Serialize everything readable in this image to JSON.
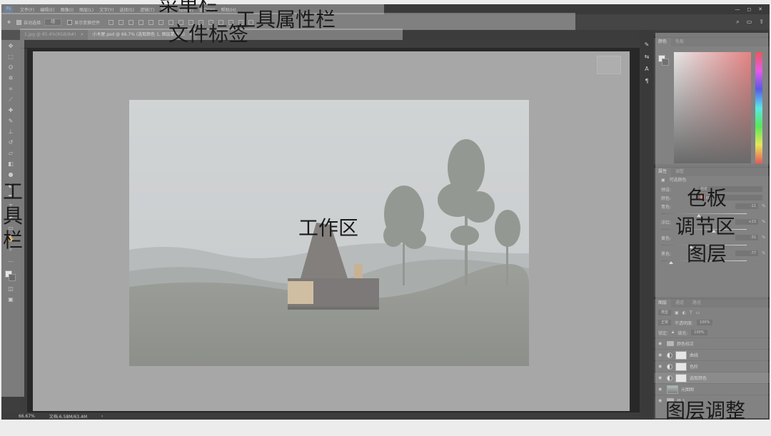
{
  "menubar": {
    "logo": "Ps",
    "items": [
      "文件(F)",
      "编辑(E)",
      "图像(I)",
      "图层(L)",
      "文字(Y)",
      "选择(S)",
      "滤镜(T)",
      "3D(D)",
      "视图(V)",
      "窗口(W)",
      "帮助(H)"
    ],
    "controls": [
      "—",
      "◻",
      "✕"
    ]
  },
  "optionsbar": {
    "auto_select_label": "自动选择:",
    "auto_select_value": "组",
    "transform_label": "显示变换控件"
  },
  "doc_tabs": [
    {
      "label": "1.jpg @ 85.4%(RGB/8#)",
      "close": "×"
    },
    {
      "label": "小木屋.psd @ 66.7% (选取颜色 1, 图层蒙版/8)",
      "close": "×"
    }
  ],
  "statusbar": {
    "zoom": "66.67%",
    "doc_size": "文档:6.58M/63.4M",
    "arrow": "›"
  },
  "color_panel": {
    "tabs": [
      "颜色",
      "色板"
    ]
  },
  "properties_panel": {
    "tabs": [
      "属性",
      "调整"
    ],
    "title": "可选颜色",
    "preset_label": "预设:",
    "preset_value": "自定",
    "colors_label": "颜色:",
    "colors_value": "红色",
    "rows": [
      {
        "label": "青色:",
        "value": "-11",
        "unit": "%",
        "pos": 0.44
      },
      {
        "label": "洋红:",
        "value": "+23",
        "unit": "%",
        "pos": 0.62
      },
      {
        "label": "黄色:",
        "value": "-31",
        "unit": "%",
        "pos": 0.35
      },
      {
        "label": "黑色:",
        "value": "-77",
        "unit": "%",
        "pos": 0.12
      }
    ]
  },
  "layers_panel": {
    "tabs": [
      "图层",
      "通道",
      "路径"
    ],
    "kind_label": "类型",
    "blend_mode": "正常",
    "opacity_label": "不透明度:",
    "opacity_value": "100%",
    "lock_label": "锁定:",
    "fill_label": "填充:",
    "fill_value": "100%",
    "layers": [
      {
        "name": "颜色校正",
        "kind": "group",
        "selected": false
      },
      {
        "name": "曲线",
        "kind": "adjustment",
        "selected": false
      },
      {
        "name": "色阶",
        "kind": "adjustment",
        "selected": false
      },
      {
        "name": "选取颜色",
        "kind": "adjustment",
        "selected": true
      },
      {
        "name": "元图图",
        "kind": "photo",
        "selected": false
      },
      {
        "name": "组 1",
        "kind": "group",
        "selected": false
      }
    ]
  },
  "annotations": {
    "menu_bar": "菜单栏",
    "options_bar": "工具属性栏",
    "doc_tab": "文件标签",
    "toolbar_chars": [
      "工",
      "具",
      "栏"
    ],
    "workspace": "工作区",
    "palette": "色板",
    "adjust": "调节区",
    "layers": "图层",
    "layer_adjust": "图层调整"
  }
}
